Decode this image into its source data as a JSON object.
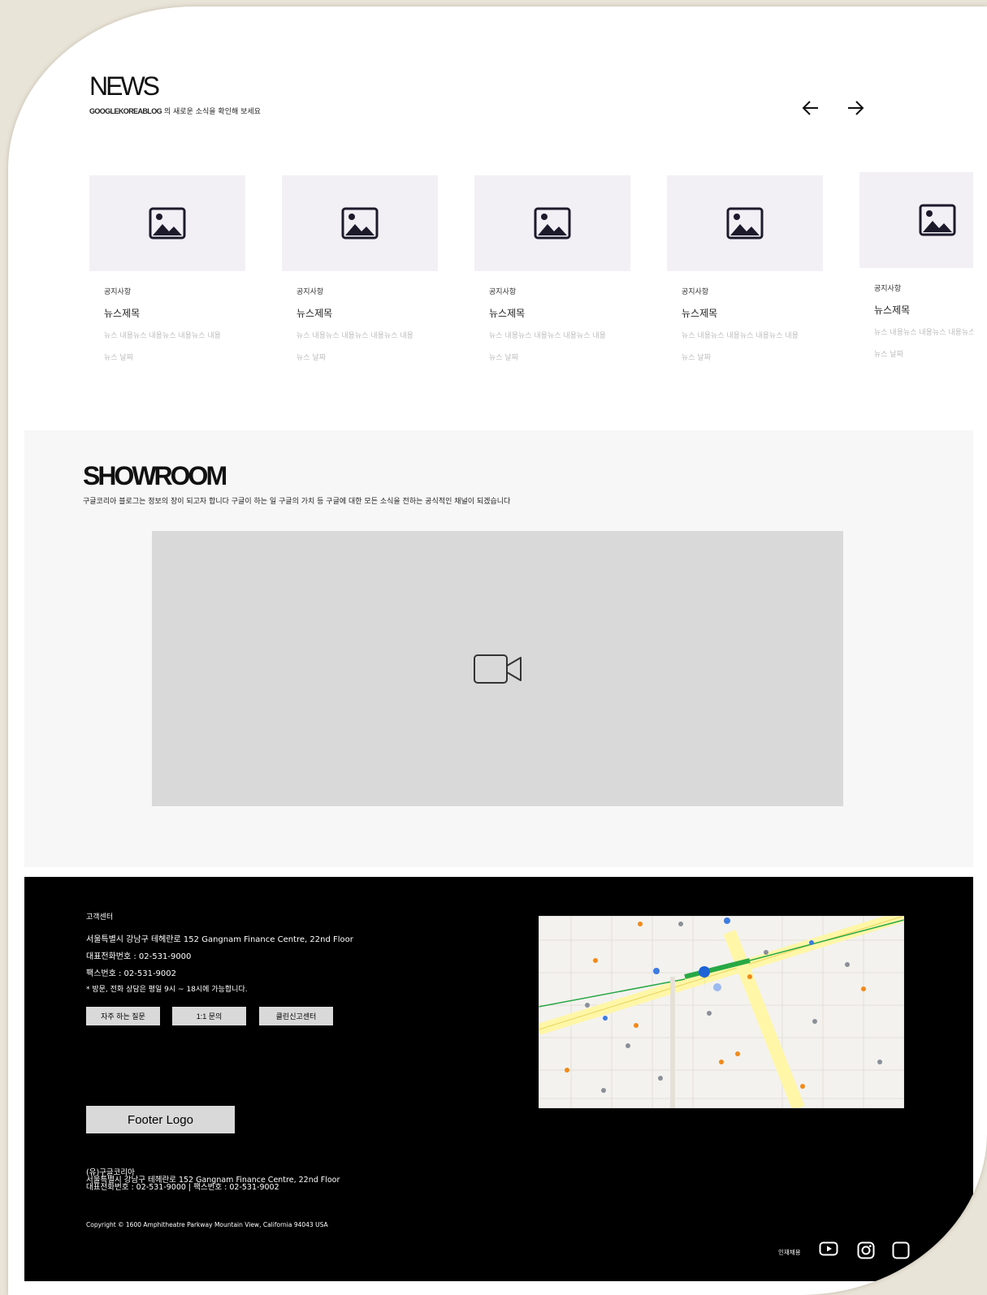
{
  "news": {
    "title": "NEWS",
    "subtitle_brand": "GOOGLEKOREABLOG",
    "subtitle_rest": " 의 새로운 소식을 확인해 보세요",
    "cards": [
      {
        "category": "공지사항",
        "title": "뉴스제목",
        "content": "뉴스 내용뉴스 내용뉴스 내용뉴스 내용",
        "date": "뉴스 날짜"
      },
      {
        "category": "공지사항",
        "title": "뉴스제목",
        "content": "뉴스 내용뉴스 내용뉴스 내용뉴스 내용",
        "date": "뉴스 날짜"
      },
      {
        "category": "공지사항",
        "title": "뉴스제목",
        "content": "뉴스 내용뉴스 내용뉴스 내용뉴스 내용",
        "date": "뉴스 날짜"
      },
      {
        "category": "공지사항",
        "title": "뉴스제목",
        "content": "뉴스 내용뉴스 내용뉴스 내용뉴스 내용",
        "date": "뉴스 날짜"
      },
      {
        "category": "공지사항",
        "title": "뉴스제목",
        "content": "뉴스 내용뉴스 내용뉴스 내용뉴스 내용",
        "date": "뉴스 날짜"
      }
    ],
    "prev_icon": "arrow-left-icon",
    "next_icon": "arrow-right-icon",
    "thumb_icon": "image-icon"
  },
  "showroom": {
    "title": "SHOWROOM",
    "subtitle": "구글코리아 블로그는 정보의 장이 되고자 합니다 구글이 하는 일 구글의 가치 등 구글에 대한 모든 소식을 전하는 공식적인 채널이 되겠습니다",
    "video_icon": "video-camera-icon"
  },
  "footer": {
    "cs_title": "고객센터",
    "address": "서울특별시 강남구 테헤란로 152 Gangnam Finance Centre, 22nd Floor",
    "phone": "대표전화번호 : 02-531-9000",
    "fax": "팩스번호 : 02-531-9002",
    "hours": "* 방문, 전화 상담은 평일 9시 ~ 18시에 가능합니다.",
    "buttons": [
      "자주 하는 질문",
      "1:1 문의",
      "클린신고센터"
    ],
    "logo": "Footer Logo",
    "company_name": "(유)구글코리아",
    "company_address": "서울특별시 강남구 테헤란로 152 Gangnam Finance Centre, 22nd Floor",
    "company_contact": "대표전화번호 : 02-531-9000 | 팩스번호 : 02-531-9002",
    "copyright": "Copyright © 1600 Amphitheatre Parkway Mountain View, California 94043 USA",
    "careers": "인재채용",
    "social_icons": [
      "youtube-icon",
      "instagram-icon",
      "facebook-icon"
    ]
  },
  "colors": {
    "thumb_bg": "#f2f0f5",
    "icon_dark": "#1c1a2b",
    "showroom_bg": "#f7f7f7",
    "video_bg": "#d9d9d9",
    "footer_bg": "#000000",
    "muted_text": "#bdbdbd"
  }
}
